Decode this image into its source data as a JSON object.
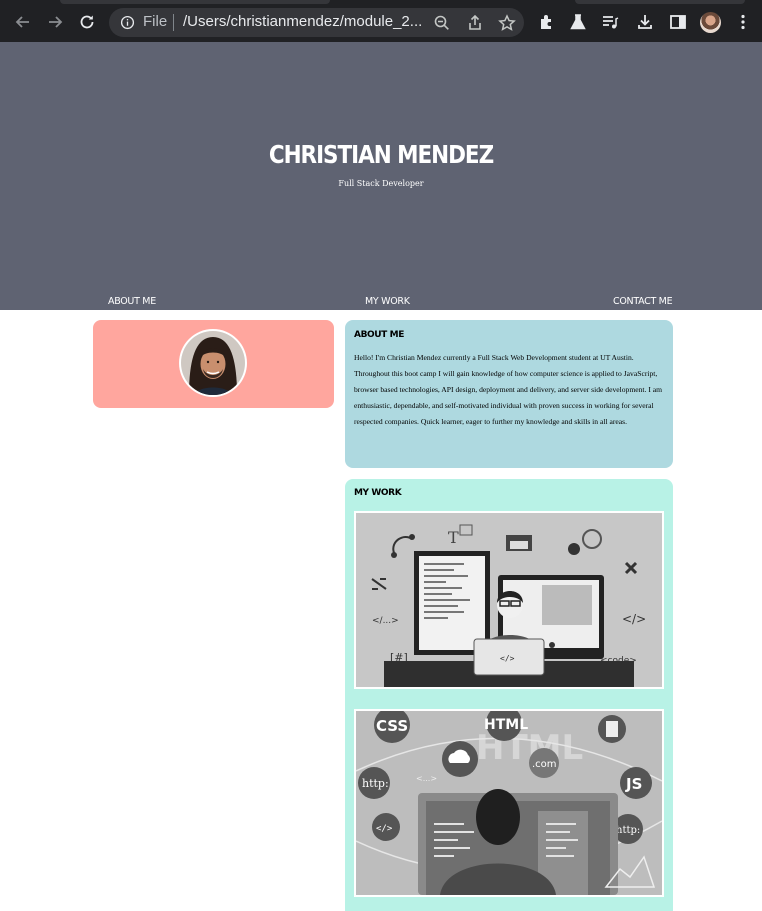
{
  "browser": {
    "address_scheme_label": "File",
    "address_url": "/Users/christianmendez/module_2...",
    "icons": {
      "back": "arrow-left-icon",
      "forward": "arrow-right-icon",
      "reload": "reload-icon",
      "site_info": "info-icon",
      "zoom": "zoom-out-icon",
      "share": "share-icon",
      "bookmark": "star-icon",
      "extensions": "puzzle-icon",
      "labs": "flask-icon",
      "reading_list": "playlist-icon",
      "downloads": "download-icon",
      "side_panel": "side-panel-icon",
      "profile": "profile-avatar",
      "menu": "kebab-menu-icon"
    }
  },
  "header": {
    "title": "CHRISTIAN MENDEZ",
    "subtitle": "Full Stack Developer",
    "nav": [
      "ABOUT ME",
      "MY WORK",
      "CONTACT ME"
    ]
  },
  "about": {
    "heading": "ABOUT ME",
    "text": "Hello! I'm Christian Mendez currently a Full Stack Web Development student at UT Austin. Throughout this boot camp I will gain knowledge of how computer science is applied to JavaScript, browser based technologies, API design, deployment and delivery, and server side development. I am enthusiastic, dependable, and self-motivated individual with proven success in working for several respected companies. Quick learner, eager to further my knowledge and skills in all areas."
  },
  "work": {
    "heading": "MY WORK",
    "image1_labels": [
      "</...>",
      "[#]",
      "</>",
      "<code>",
      "</>",
      "T"
    ],
    "image2_labels": [
      "CSS",
      "HTML",
      "http:",
      "JS",
      ".com",
      "http:",
      "<...>"
    ]
  },
  "colors": {
    "chrome_bg": "#202124",
    "hero_bg": "#5f6372",
    "photo_card": "#ffa69e",
    "about_card": "#aed9e0",
    "work_card": "#b8f2e6"
  }
}
